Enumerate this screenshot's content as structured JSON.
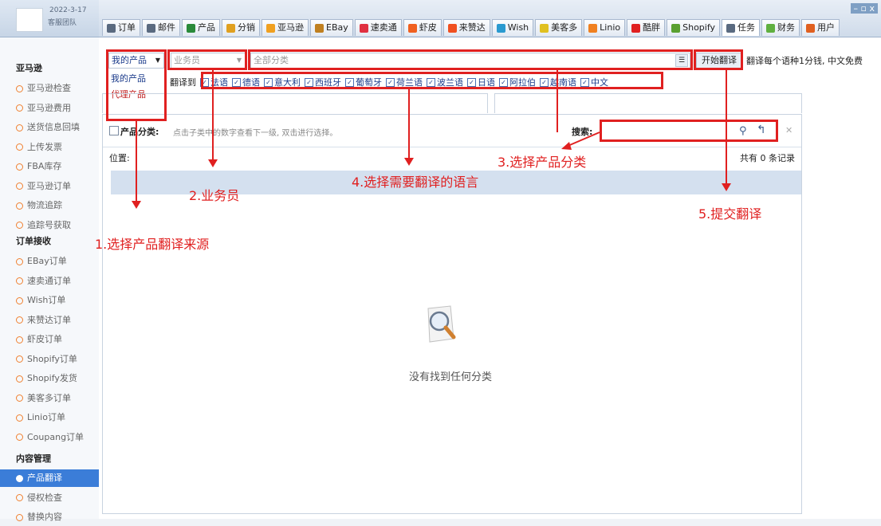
{
  "app": {
    "date": "2022-3-17",
    "team": "客服团队"
  },
  "tabs": [
    {
      "label": "订单",
      "color": "#5a6a80"
    },
    {
      "label": "邮件",
      "color": "#5a6a80"
    },
    {
      "label": "产品",
      "color": "#2a8a3a"
    },
    {
      "label": "分销",
      "color": "#e0a020"
    },
    {
      "label": "亚马逊",
      "color": "#f0a020"
    },
    {
      "label": "EBay",
      "color": "#c08020"
    },
    {
      "label": "速卖通",
      "color": "#e03040"
    },
    {
      "label": "虾皮",
      "color": "#f06020"
    },
    {
      "label": "来赞达",
      "color": "#f05020"
    },
    {
      "label": "Wish",
      "color": "#2a9ad0"
    },
    {
      "label": "美客多",
      "color": "#e0c020"
    },
    {
      "label": "Linio",
      "color": "#f08020"
    },
    {
      "label": "酷胖",
      "color": "#e02020"
    },
    {
      "label": "Shopify",
      "color": "#5aa030"
    },
    {
      "label": "任务",
      "color": "#5a6a80"
    },
    {
      "label": "财务",
      "color": "#60b040"
    },
    {
      "label": "用户",
      "color": "#e06020"
    }
  ],
  "window_controls": "– ▫ x",
  "sidebar": {
    "section1": "亚马逊",
    "items1": [
      "亚马逊检查",
      "亚马逊费用",
      "送货信息回填",
      "上传发票",
      "FBA库存",
      "亚马逊订单",
      "物流追踪",
      "追踪号获取"
    ],
    "section2": "订单接收",
    "items2": [
      "EBay订单",
      "速卖通订单",
      "Wish订单",
      "来赞达订单",
      "虾皮订单",
      "Shopify订单",
      "Shopify发货",
      "美客多订单",
      "Linio订单",
      "Coupang订单"
    ],
    "section3": "内容管理",
    "items3": [
      "产品翻译",
      "侵权检查",
      "替换内容"
    ]
  },
  "toolbar": {
    "source_value": "我的产品",
    "source_options": [
      "我的产品",
      "代理产品"
    ],
    "salesman_placeholder": "业务员",
    "category_placeholder": "全部分类",
    "submit_label": "开始翻译",
    "price_note": "翻译每个语种1分钱, 中文免费",
    "translate_to_label": "翻译到",
    "languages": [
      "法语",
      "德语",
      "意大利",
      "西班牙",
      "葡萄牙",
      "荷兰语",
      "波兰语",
      "日语",
      "阿拉伯",
      "越南语",
      "中文"
    ]
  },
  "panel": {
    "title": "产品分类:",
    "hint": "点击子类中的数字查看下一级, 双击进行选择。",
    "search_label": "搜索:",
    "position_label": "位置:",
    "record_count": "共有 0 条记录",
    "empty_text": "没有找到任何分类"
  },
  "annotations": [
    "1.选择产品翻译来源",
    "2.业务员",
    "3.选择产品分类",
    "4.选择需要翻译的语言",
    "5.提交翻译"
  ]
}
